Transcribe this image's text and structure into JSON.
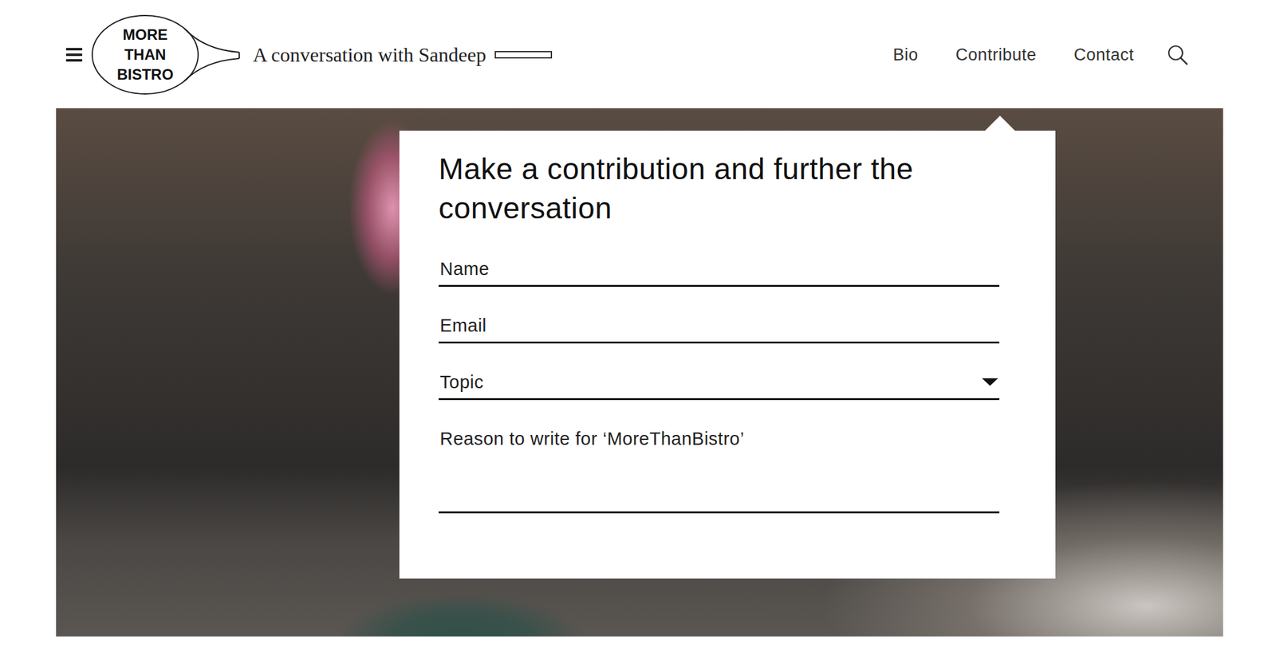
{
  "header": {
    "logo": {
      "lines": [
        "MORE",
        "THAN",
        "BISTRO"
      ]
    },
    "tagline": "A conversation with Sandeep",
    "nav": [
      {
        "label": "Bio"
      },
      {
        "label": "Contribute"
      },
      {
        "label": "Contact"
      }
    ]
  },
  "form": {
    "title": "Make a contribution and further the conversation",
    "fields": [
      {
        "label": "Name",
        "kind": "text"
      },
      {
        "label": "Email",
        "kind": "text"
      },
      {
        "label": "Topic",
        "kind": "select"
      },
      {
        "label": "Reason to write for ‘MoreThanBistro’",
        "kind": "textarea"
      }
    ]
  }
}
